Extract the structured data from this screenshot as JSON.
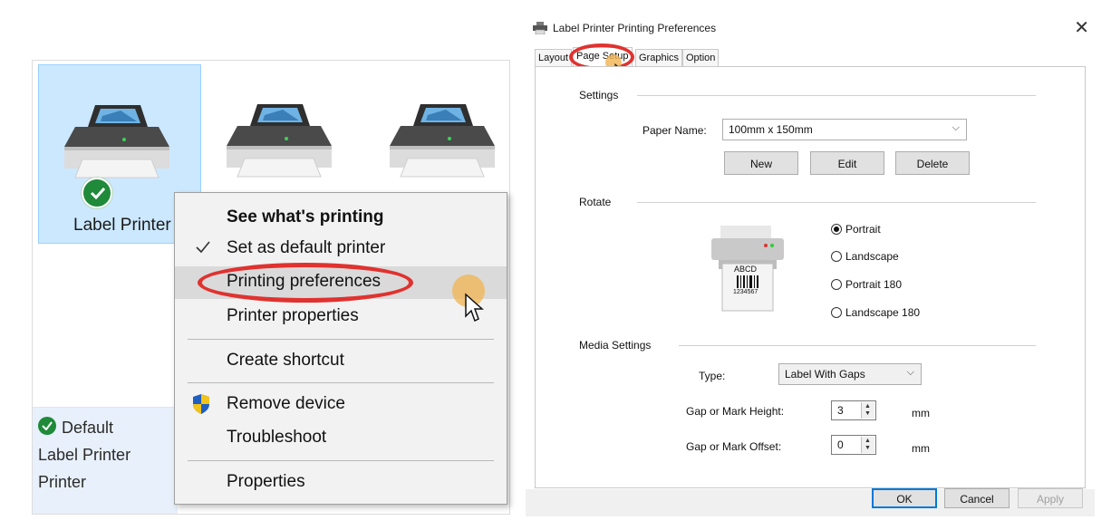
{
  "left_panel": {
    "printers": [
      {
        "label": "Label Printer",
        "selected": true,
        "default": true
      },
      {
        "label": "",
        "selected": false,
        "default": false
      },
      {
        "label": "",
        "selected": false,
        "default": false
      }
    ],
    "details": {
      "line1": "Default",
      "line2": "Label Printer",
      "line3": "Printer"
    }
  },
  "context_menu": {
    "items": [
      {
        "label": "See what's printing",
        "bold": true
      },
      {
        "label": "Set as default printer",
        "checked": true
      },
      {
        "label": "Printing preferences",
        "highlighted": true
      },
      {
        "label": "Printer properties"
      },
      {
        "label": "Create shortcut"
      },
      {
        "label": "Remove device",
        "icon": "shield-icon"
      },
      {
        "label": "Troubleshoot"
      },
      {
        "label": "Properties"
      }
    ]
  },
  "dialog": {
    "title": "Label Printer Printing Preferences",
    "close_glyph": "✕",
    "tabs": [
      "Layout",
      "Page Setup",
      "Graphics",
      "Option"
    ],
    "active_tab": "Page Setup",
    "settings": {
      "group_label": "Settings",
      "paper_name_label": "Paper Name:",
      "paper_name_value": "100mm x 150mm",
      "new_label": "New",
      "edit_label": "Edit",
      "delete_label": "Delete"
    },
    "rotate": {
      "group_label": "Rotate",
      "preview_text": "ABCD",
      "preview_number": "1234567",
      "options": [
        "Portrait",
        "Landscape",
        "Portrait 180",
        "Landscape 180"
      ],
      "selected": "Portrait"
    },
    "media": {
      "group_label": "Media Settings",
      "type_label": "Type:",
      "type_value": "Label With Gaps",
      "gap_height_label": "Gap or Mark Height:",
      "gap_height_value": "3",
      "gap_offset_label": "Gap or Mark Offset:",
      "gap_offset_value": "0",
      "unit": "mm"
    },
    "footer": {
      "ok_label": "OK",
      "cancel_label": "Cancel",
      "apply_label": "Apply"
    }
  },
  "colors": {
    "annotation_red": "#e0322f",
    "selection_blue": "#cce8ff",
    "default_green": "#1f8a3a"
  }
}
